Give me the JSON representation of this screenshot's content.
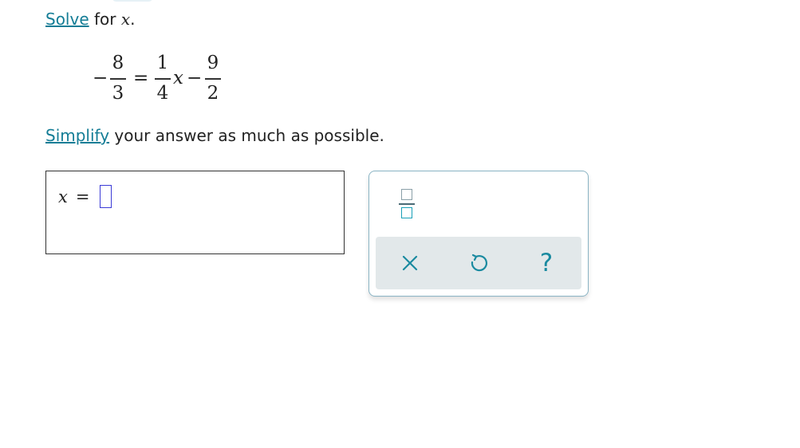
{
  "instruction": {
    "link_text": "Solve",
    "text": " for ",
    "variable": "x",
    "end": "."
  },
  "equation": {
    "lhs_sign": "−",
    "lhs_numerator": "8",
    "lhs_denominator": "3",
    "equals": "=",
    "coef_numerator": "1",
    "coef_denominator": "4",
    "variable": "x",
    "minus": "−",
    "const_numerator": "9",
    "const_denominator": "2"
  },
  "simplify": {
    "link_text": "Simplify",
    "text": " your answer as much as possible."
  },
  "answer": {
    "variable": "x",
    "equals": "=",
    "value": ""
  },
  "palette": {
    "fraction_tool": "fraction-icon",
    "clear_tool": "close-icon",
    "undo_tool": "undo-icon",
    "help_label": "?",
    "accent_color": "#1a8aa0"
  }
}
